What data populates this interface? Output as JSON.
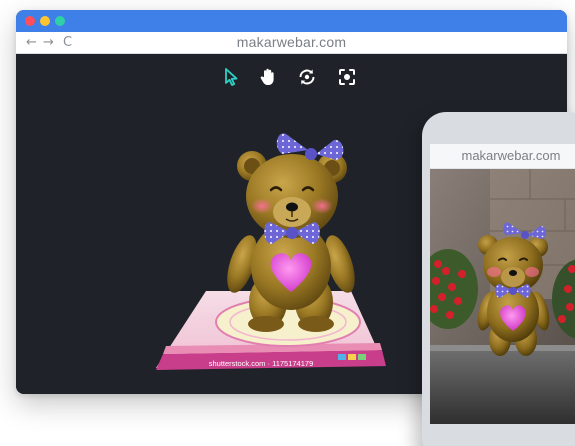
{
  "browser": {
    "window_buttons": [
      "close",
      "minimize",
      "maximize"
    ],
    "nav": {
      "back_icon": "←",
      "forward_icon": "→",
      "reload_icon": "C"
    },
    "url": "makarwebar.com"
  },
  "viewer": {
    "tools": [
      {
        "name": "select-icon",
        "active": true
      },
      {
        "name": "pan-hand-icon",
        "active": false
      },
      {
        "name": "rotate-icon",
        "active": false
      },
      {
        "name": "focus-icon",
        "active": false
      }
    ],
    "marker_caption": "shutterstock.com · 1175174179"
  },
  "phone": {
    "url": "makarwebar.com"
  },
  "colors": {
    "titlebar": "#3f7fe8",
    "close": "#ff4f5a",
    "minimize": "#ffc531",
    "maximize": "#2ed1a6",
    "viewport_bg": "#1f2329",
    "tool_active": "#2ed1c4",
    "tool_default": "#ffffff"
  }
}
